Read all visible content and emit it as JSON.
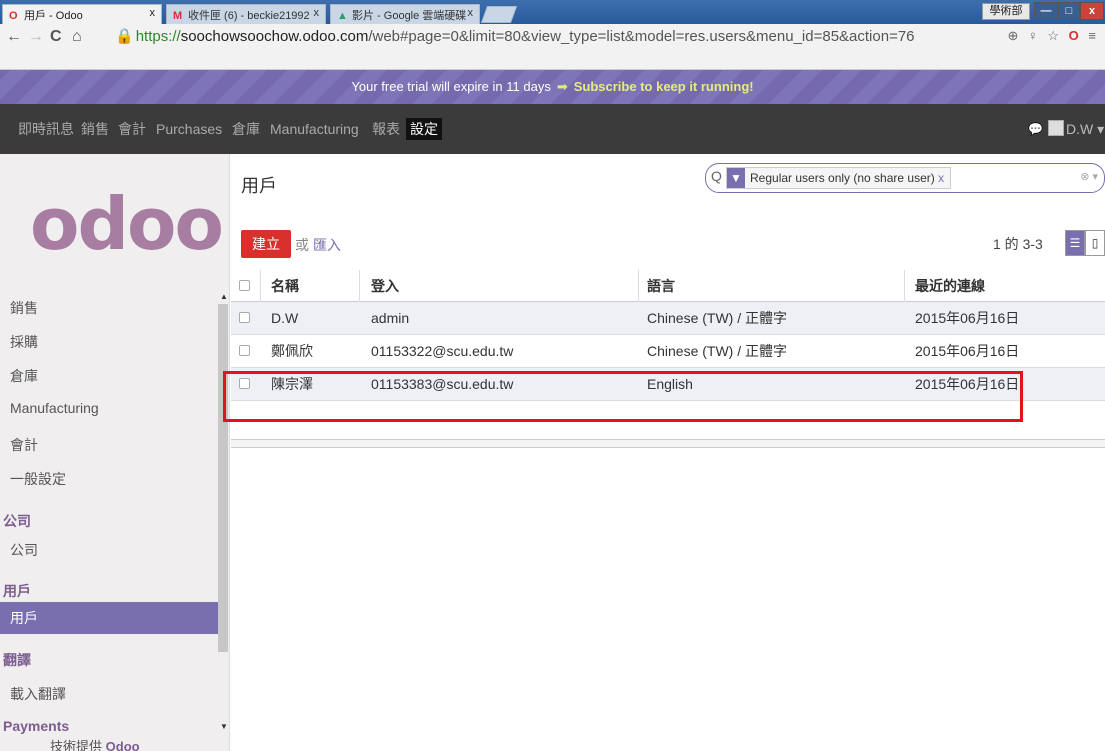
{
  "browser": {
    "tabs": [
      {
        "icon": "O",
        "title": "用戶 - Odoo",
        "close": "x"
      },
      {
        "icon": "M",
        "title": "收件匣 (6) - beckie21992",
        "close": "x"
      },
      {
        "icon": "▲",
        "title": "影片 - Google 雲端硬碟",
        "close": "x"
      }
    ],
    "user_badge": "學術部",
    "window_buttons": {
      "minimize": "—",
      "maximize": "□",
      "close": "x"
    },
    "url_lock": "🔒",
    "url_protocol": "https://",
    "url_host": "soochowsoochow.odoo.com",
    "url_path": "/web#page=0&limit=80&view_type=list&model=res.users&menu_id=85&action=76",
    "addr_icons": "⊕ ♀ ☆",
    "opera_icon": "O",
    "menu_icon": "≡"
  },
  "trial_banner": {
    "text": "Your free trial will expire in 11 days",
    "arrow": "➡",
    "link": "Subscribe to keep it running!"
  },
  "topmenu": {
    "items": [
      "即時訊息",
      "銷售",
      "會計",
      "Purchases",
      "倉庫",
      "Manufacturing",
      "報表",
      "設定"
    ],
    "active": "設定",
    "chat_icon": "💬",
    "user": "D.W ▾"
  },
  "sidebar": {
    "logo": "odoo",
    "items": [
      {
        "label": "銷售",
        "kind": "item"
      },
      {
        "label": "採購",
        "kind": "item"
      },
      {
        "label": "倉庫",
        "kind": "item"
      },
      {
        "label": "Manufacturing",
        "kind": "item"
      },
      {
        "label": "會計",
        "kind": "item"
      },
      {
        "label": "一般設定",
        "kind": "item"
      },
      {
        "label": "公司",
        "kind": "head"
      },
      {
        "label": "公司",
        "kind": "item"
      },
      {
        "label": "用戶",
        "kind": "head"
      },
      {
        "label": "用戶",
        "kind": "active"
      },
      {
        "label": "翻譯",
        "kind": "head"
      },
      {
        "label": "載入翻譯",
        "kind": "item"
      },
      {
        "label": "Payments",
        "kind": "head"
      }
    ],
    "powered_by": "技術提供",
    "powered_brand": "Odoo"
  },
  "main": {
    "title": "用戶",
    "search": {
      "facet_icon": "▼",
      "facet_text": "Regular users only (no share user)",
      "facet_remove": "x",
      "clear": "⊗ ▾",
      "search_icon": "Q"
    },
    "create_label": "建立",
    "or_text": "或",
    "import_label": "匯入",
    "pager": "1 的 3-3",
    "list_view_icon": "☰",
    "form_view_icon": "▯",
    "columns": [
      "名稱",
      "登入",
      "語言",
      "最近的連線"
    ],
    "rows": [
      {
        "name": "D.W",
        "login": "admin",
        "lang": "Chinese (TW) / 正體字",
        "last": "2015年06月16日"
      },
      {
        "name": "鄭佩欣",
        "login": "01153322@scu.edu.tw",
        "lang": "Chinese (TW) / 正體字",
        "last": "2015年06月16日"
      },
      {
        "name": "陳宗澤",
        "login": "01153383@scu.edu.tw",
        "lang": "English",
        "last": "2015年06月16日"
      }
    ]
  }
}
